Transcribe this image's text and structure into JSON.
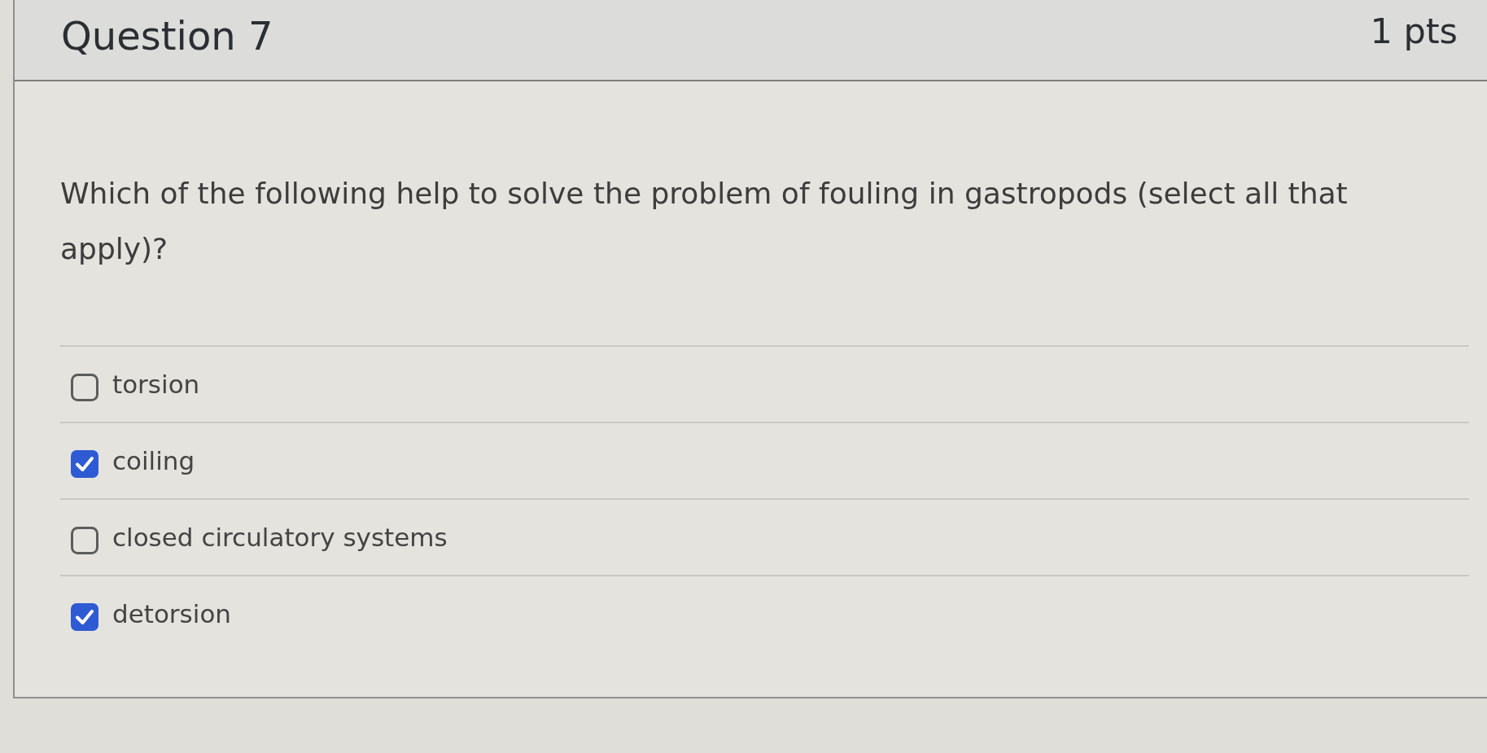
{
  "question": {
    "title": "Question 7",
    "points": "1 pts",
    "text": "Which of the following help to solve the problem of fouling in gastropods (select all that apply)?"
  },
  "answers": [
    {
      "label": "torsion",
      "checked": false
    },
    {
      "label": "coiling",
      "checked": true
    },
    {
      "label": "closed circulatory systems",
      "checked": false
    },
    {
      "label": "detorsion",
      "checked": true
    }
  ]
}
